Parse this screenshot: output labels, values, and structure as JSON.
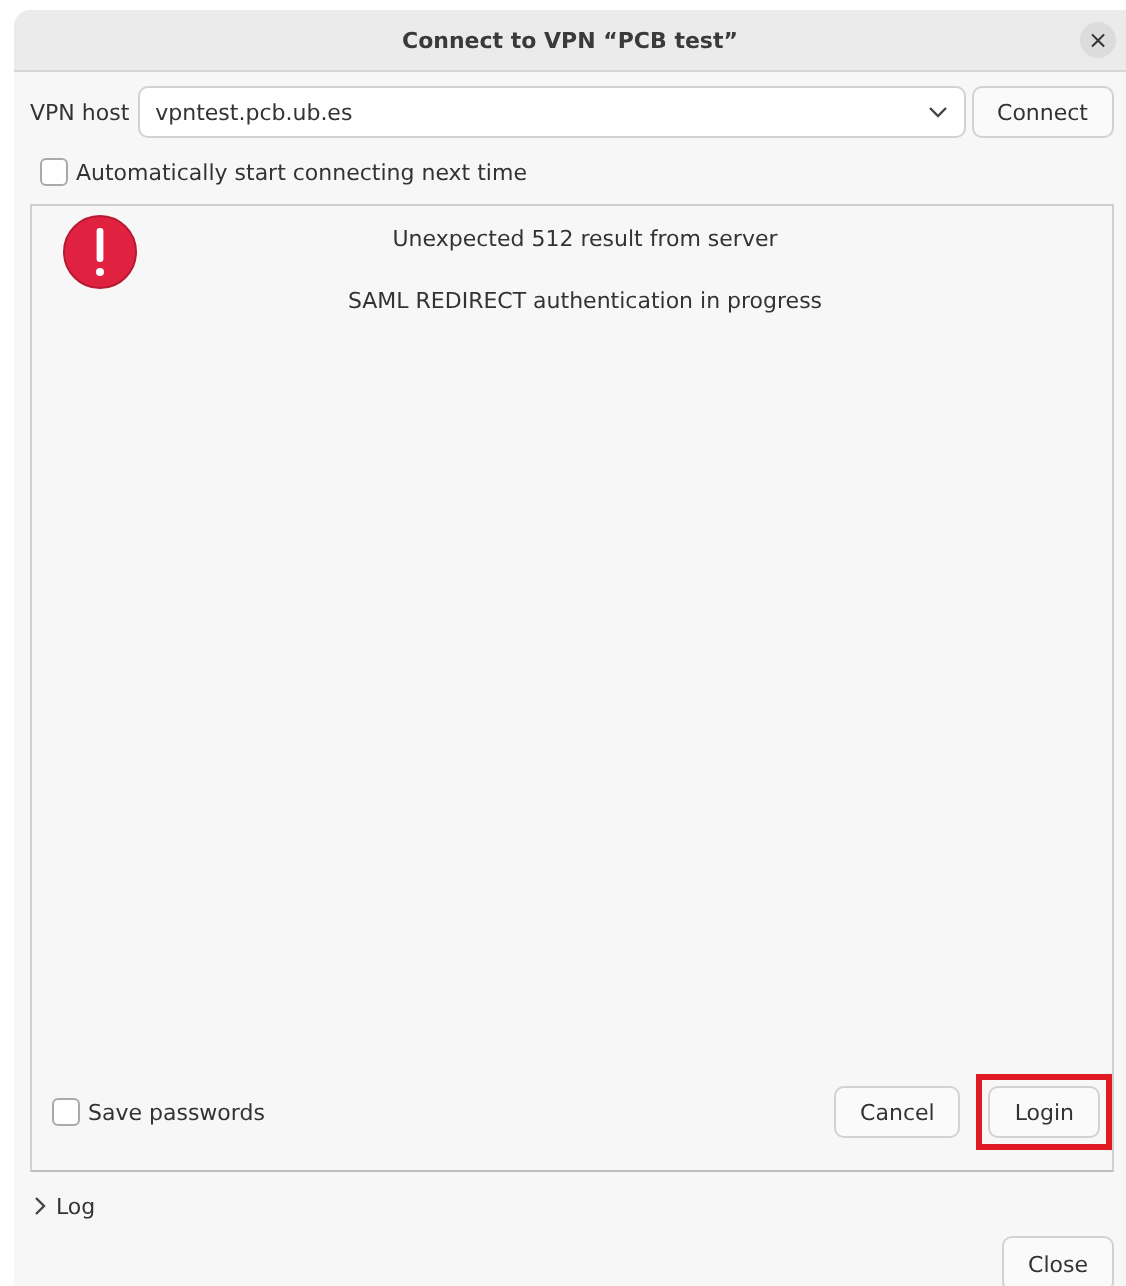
{
  "window": {
    "title": "Connect to VPN “PCB test”",
    "close_glyph": "×"
  },
  "host": {
    "label": "VPN host",
    "value": "vpntest.pcb.ub.es",
    "connect_button": "Connect"
  },
  "autostart": {
    "label": "Automatically start connecting next time",
    "checked": false
  },
  "messages": [
    "Unexpected 512 result from server",
    "SAML REDIRECT authentication in progress"
  ],
  "save_passwords": {
    "label": "Save passwords",
    "checked": false
  },
  "buttons": [
    {
      "label": "Cancel",
      "highlighted": false
    },
    {
      "label": "Login",
      "highlighted": true
    }
  ],
  "log": {
    "label": "Log",
    "expanded": false
  },
  "close_button": "Close"
}
